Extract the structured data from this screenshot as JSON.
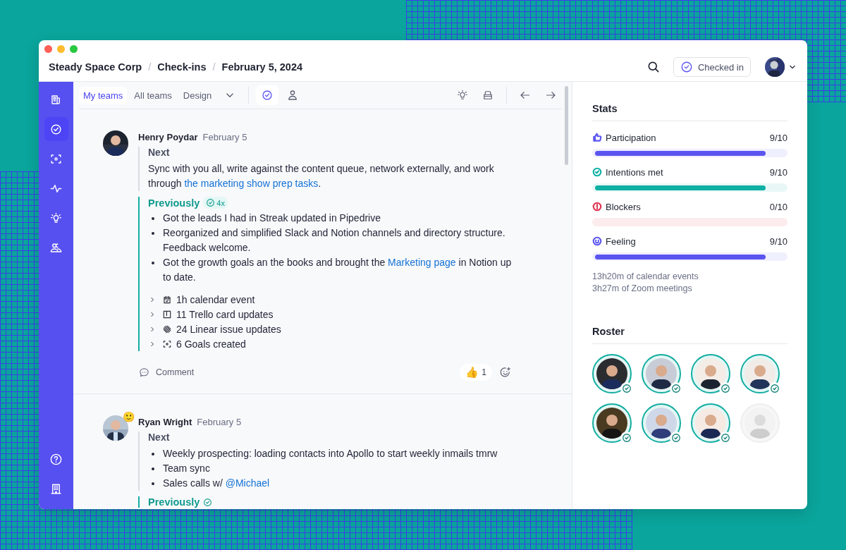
{
  "breadcrumb": [
    {
      "kind": "crumb",
      "text": "Steady Space Corp"
    },
    {
      "kind": "separator",
      "text": "/"
    },
    {
      "kind": "crumb",
      "text": "Check-ins"
    },
    {
      "kind": "separator",
      "text": "/"
    },
    {
      "kind": "crumb",
      "text": "February 5, 2024"
    }
  ],
  "checkin_button": {
    "label": "Checked in"
  },
  "tabs": [
    {
      "label": "My teams",
      "selected": true
    },
    {
      "label": "All teams",
      "selected": false
    },
    {
      "label": "Design",
      "selected": false
    }
  ],
  "view_toggle": [
    {
      "kind": "checkins",
      "selected": true
    },
    {
      "kind": "person",
      "selected": false
    }
  ],
  "sidebar": {
    "items": [
      {
        "kind": "news",
        "selected": false
      },
      {
        "kind": "checkins",
        "selected": true
      },
      {
        "kind": "goals",
        "selected": false
      },
      {
        "kind": "pulse",
        "selected": false
      },
      {
        "kind": "ideas",
        "selected": false
      },
      {
        "kind": "people",
        "selected": false
      }
    ],
    "bottom": [
      {
        "kind": "help"
      },
      {
        "kind": "company"
      }
    ]
  },
  "entries": [
    {
      "name": "Henry Poydar",
      "date": "February 5",
      "next_title": "Next",
      "next": {
        "kind": "paragraph",
        "segments": [
          {
            "text": "Sync with you all, write against the content queue, network externally, and work through "
          },
          {
            "text": "the marketing show prep tasks",
            "link": true
          },
          {
            "text": "."
          }
        ]
      },
      "previously": {
        "title": "Previously",
        "count": "4x",
        "items": [
          [
            {
              "text": "Got the leads I had in Streak updated in Pipedrive"
            }
          ],
          [
            {
              "text": "Reorganized and simplified Slack and Notion channels and directory structure. Feedback welcome."
            }
          ],
          [
            {
              "text": "Got the growth goals an the books and brought the "
            },
            {
              "text": "Marketing page",
              "link": true
            },
            {
              "text": " in Notion up to date."
            }
          ]
        ]
      },
      "activities": [
        {
          "kind": "calendar",
          "label": "1h calendar event",
          "expanded": false
        },
        {
          "kind": "board",
          "label": "11 Trello card updates",
          "expanded": false
        },
        {
          "kind": "linear",
          "label": "24 Linear issue updates",
          "expanded": false
        },
        {
          "kind": "goals",
          "label": "6 Goals created",
          "expanded": false
        }
      ],
      "comment": "Comment",
      "reactions": [
        {
          "emoji": "👍",
          "count": "1"
        }
      ]
    },
    {
      "name": "Ryan Wright",
      "date": "February 5",
      "status_emoji": "🙂",
      "next_title": "Next",
      "next": {
        "kind": "list",
        "items": [
          [
            {
              "text": "Weekly prospecting: loading contacts into Apollo to start weekly inmails tmrw"
            }
          ],
          [
            {
              "text": "Team sync"
            }
          ],
          [
            {
              "text": "Sales calls w/ "
            },
            {
              "text": "@Michael",
              "link": true
            }
          ]
        ]
      },
      "previously": {
        "title": "Previously"
      }
    }
  ],
  "stats": {
    "title": "Stats",
    "items": [
      {
        "kind": "thumb",
        "label": "Participation",
        "value": "9/10",
        "level": 0.9,
        "color": "#5b55f0"
      },
      {
        "kind": "check",
        "label": "Intentions met",
        "value": "9/10",
        "level": 0.9,
        "color": "#0fb0a4"
      },
      {
        "kind": "alert",
        "label": "Blockers",
        "value": "0/10",
        "color": "#e0334f"
      },
      {
        "kind": "smile",
        "label": "Feeling",
        "value": "9/10",
        "level": 0.9,
        "color": "#5b55f0"
      }
    ],
    "notes": [
      "13h20m of calendar events",
      "3h27m of Zoom meetings"
    ]
  },
  "roster": {
    "title": "Roster",
    "members": [
      {
        "checked": true
      },
      {
        "checked": true
      },
      {
        "checked": true
      },
      {
        "checked": true
      },
      {
        "checked": true
      },
      {
        "checked": true
      },
      {
        "checked": true
      },
      {
        "checked": false
      }
    ]
  }
}
